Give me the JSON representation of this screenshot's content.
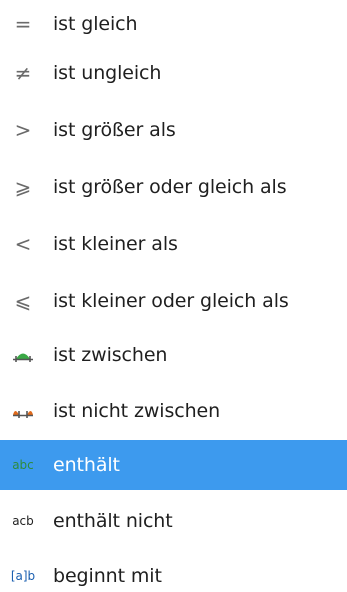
{
  "menu": {
    "items": [
      {
        "label": "ist gleich",
        "icon": "equals-icon",
        "symbol": "="
      },
      {
        "label": "ist ungleich",
        "icon": "not-equal-icon",
        "symbol": "≠"
      },
      {
        "label": "ist größer als",
        "icon": "greater-than-icon",
        "symbol": ">"
      },
      {
        "label": "ist größer oder gleich als",
        "icon": "greater-or-equal-icon",
        "symbol": "⩾"
      },
      {
        "label": "ist kleiner als",
        "icon": "less-than-icon",
        "symbol": "<"
      },
      {
        "label": "ist kleiner oder gleich als",
        "icon": "less-or-equal-icon",
        "symbol": "⩽"
      },
      {
        "label": "ist zwischen",
        "icon": "between-icon"
      },
      {
        "label": "ist nicht zwischen",
        "icon": "not-between-icon"
      },
      {
        "label": "enthält",
        "icon": "contains-icon",
        "symbol": "abc",
        "selected": true
      },
      {
        "label": "enthält nicht",
        "icon": "not-contains-icon",
        "symbol": "acb"
      },
      {
        "label": "beginnt mit",
        "icon": "begins-with-icon",
        "symbol": "[a]b"
      }
    ]
  },
  "colors": {
    "selected_bg": "#3d9aee",
    "selected_text": "#ffffff",
    "text": "#1f1f1f",
    "icon_gray": "#6a6a6a",
    "green": "#3aa845",
    "orange": "#e06a1b"
  }
}
